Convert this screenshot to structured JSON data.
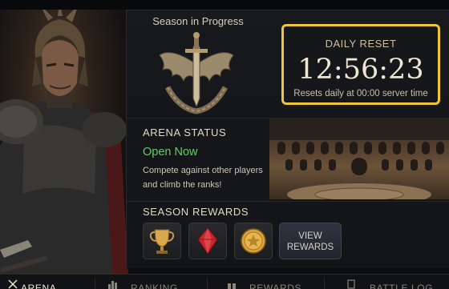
{
  "season": {
    "title": "Season in Progress"
  },
  "daily_reset": {
    "label": "DAILY RESET",
    "time": "12:56:23",
    "subtitle": "Resets daily at 00:00 server time",
    "accent": "#f0c53a"
  },
  "arena": {
    "title": "ARENA STATUS",
    "status": "Open Now",
    "status_color": "#5fcf5f",
    "description": "Compete against other players and climb the ranks!"
  },
  "rewards": {
    "title": "SEASON REWARDS",
    "items": [
      {
        "icon": "trophy-icon"
      },
      {
        "icon": "red-gem-icon"
      },
      {
        "icon": "gold-coin-icon"
      }
    ],
    "view_label_line1": "VIEW",
    "view_label_line2": "REWARDS"
  },
  "nav": {
    "items": [
      {
        "label": "ARENA",
        "active": true
      },
      {
        "label": "RANKING",
        "active": false
      },
      {
        "label": "REWARDS",
        "active": false
      },
      {
        "label": "BATTLE LOG",
        "active": false
      }
    ]
  }
}
